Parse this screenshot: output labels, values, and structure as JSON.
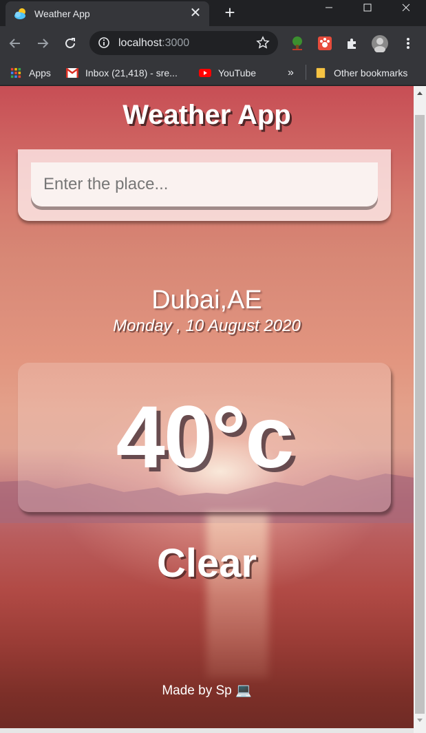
{
  "browser": {
    "tab": {
      "title": "Weather App",
      "favicon": "weather-cloud-sun-icon"
    },
    "new_tab_icon": "plus-icon",
    "window_controls": [
      "minimize-icon",
      "maximize-icon",
      "close-icon"
    ],
    "address": {
      "host": "localhost",
      "port": ":3000"
    },
    "bookmarks": [
      {
        "label": "Apps",
        "icon": "apps-grid-icon"
      },
      {
        "label": "Inbox (21,418) - sre...",
        "icon": "gmail-icon"
      },
      {
        "label": "YouTube",
        "icon": "youtube-icon"
      }
    ],
    "overflow_label": "»",
    "other_bookmarks": "Other bookmarks"
  },
  "page": {
    "title": "Weather App",
    "search": {
      "placeholder": "Enter the place...",
      "value": ""
    },
    "location": "Dubai,AE",
    "date": "Monday , 10 August 2020",
    "temperature": "40°c",
    "condition": "Clear",
    "footer": "Made by Sp 💻"
  },
  "colors": {
    "chrome_dark": "#202124",
    "chrome_toolbar": "#35363a",
    "text_light": "#e8eaed",
    "youtube_red": "#ff0000",
    "gmail_red": "#d93025"
  }
}
